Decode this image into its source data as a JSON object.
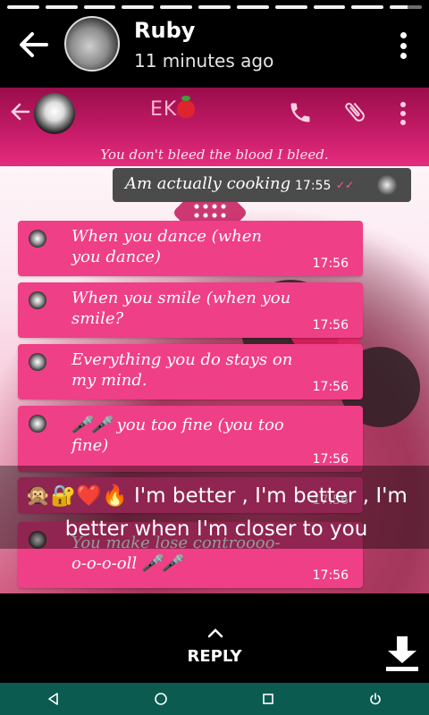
{
  "story": {
    "sender": "Ruby",
    "time_ago": "11 minutes ago",
    "caption": "🙊🔐❤️🔥 I'm better , I'm better , I'm better when I'm closer to you",
    "reply_label": "REPLY"
  },
  "chat": {
    "contact_name": "EK",
    "status_line": "You don't bleed the blood I bleed.",
    "sent": {
      "text": "Am actually cooking",
      "time": "17:55"
    },
    "received": [
      {
        "text": "When you dance (when you dance)",
        "time": "17:56"
      },
      {
        "text": "When you smile (when you smile?",
        "time": "17:56"
      },
      {
        "text": "Everything you do stays on my mind.",
        "time": "17:56"
      },
      {
        "text": "🎤🎤 you too fine (you too fine)",
        "time": "17:56"
      },
      {
        "text": "",
        "time": "17:56"
      },
      {
        "text": "You make lose controooo-o-o-o-oll 🎤🎤",
        "time": "17:56"
      }
    ]
  },
  "colors": {
    "header_pink": "#c81d6a",
    "bubble_pink": "#ef3f86",
    "sent_gray": "#4b4b4b",
    "navbar_teal": "#0b5b50"
  },
  "icons": {
    "back": "arrow-left-icon",
    "more": "more-vert-icon",
    "call": "phone-icon",
    "attach": "paperclip-icon",
    "reply": "chevron-up-icon",
    "download": "download-icon",
    "nav_back": "triangle-back-icon",
    "nav_home": "circle-home-icon",
    "nav_recents": "square-recents-icon",
    "nav_power": "power-icon"
  }
}
